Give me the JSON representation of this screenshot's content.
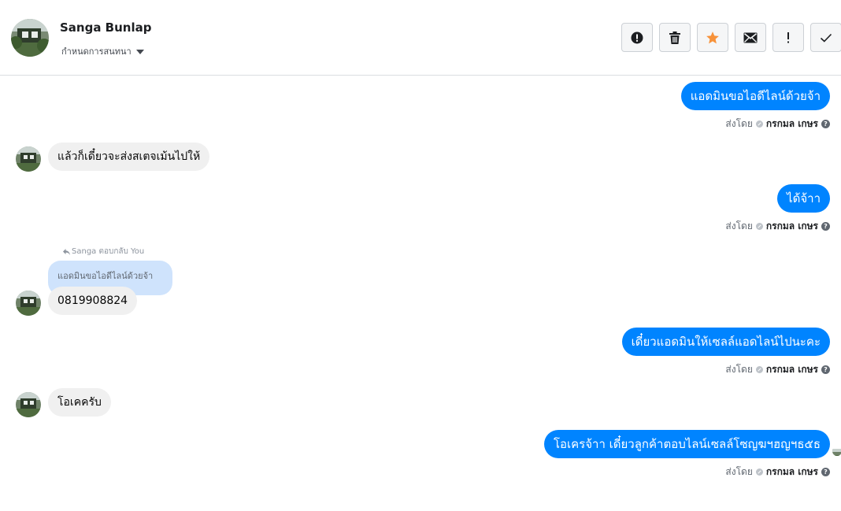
{
  "header": {
    "contact_name": "Sanga Bunlap",
    "assign_label": "กำหนดการสนทนา",
    "toolbar": [
      {
        "name": "mark-spam-button",
        "icon": "alert-circle-icon"
      },
      {
        "name": "delete-button",
        "icon": "trash-icon"
      },
      {
        "name": "star-button",
        "icon": "star-icon"
      },
      {
        "name": "mark-unread-button",
        "icon": "envelope-icon"
      },
      {
        "name": "follow-up-button",
        "icon": "exclamation-icon"
      },
      {
        "name": "mark-done-button",
        "icon": "check-icon"
      }
    ]
  },
  "messages": [
    {
      "direction": "out",
      "text": "แอดมินขอไอดีไลน์ด้วยจ้า",
      "sent_by_label": "ส่งโดย",
      "agent": "กรกมล เกษร"
    },
    {
      "direction": "in",
      "text": "แล้วก็เดี๋ยวจะส่งสเตจเม้นไปให้"
    },
    {
      "direction": "out",
      "text": "ได้จ้าา",
      "sent_by_label": "ส่งโดย",
      "agent": "กรกมล เกษร"
    },
    {
      "direction": "in",
      "reply_label": "Sanga ตอบกลับ You",
      "reply_quote": "แอดมินขอไอดีไลน์ด้วยจ้า",
      "text": "0819908824"
    },
    {
      "direction": "out",
      "text": "เดี๋ยวแอดมินให้เซลล์แอดไลน์ไปนะคะ",
      "sent_by_label": "ส่งโดย",
      "agent": "กรกมล เกษร"
    },
    {
      "direction": "in",
      "text": "โอเคครับ"
    },
    {
      "direction": "out",
      "text": "โอเครจ้าา เดี๋ยวลูกค้าตอบไลน์เซลล์โซญฆฯฮญฯธ๕ธ",
      "sent_by_label": "ส่งโดย",
      "agent": "กรกมล เกษร"
    }
  ],
  "colors": {
    "outgoing_bubble": "#0084ff",
    "incoming_bubble": "#f0f0f0",
    "reply_bubble": "#cfe3fc",
    "star": "#f7923a"
  }
}
